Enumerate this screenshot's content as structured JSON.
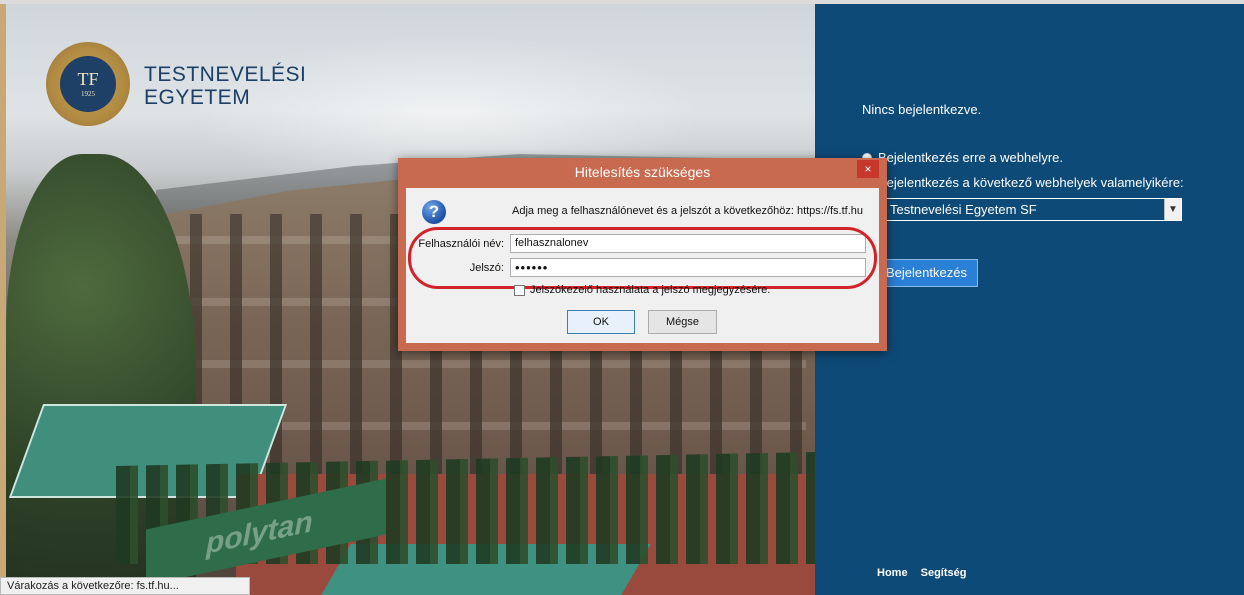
{
  "brand": {
    "line1": "TESTNEVELÉSI",
    "line2": "EGYETEM",
    "logo_letters": "TF",
    "logo_year": "1925"
  },
  "panel": {
    "not_logged_in": "Nincs bejelentkezve.",
    "option_this_site": "Bejelentkezés erre a webhelyre.",
    "option_other_sites": "Bejelentkezés a következő webhelyek valamelyikére:",
    "site_selected": "Testnevelési Egyetem SF",
    "login_button": "Bejelentkezés",
    "footer_home": "Home",
    "footer_help": "Segítség"
  },
  "dialog": {
    "title": "Hitelesítés szükséges",
    "close": "×",
    "prompt": "Adja meg a felhasználónevet és a jelszót a következőhöz: https://fs.tf.hu",
    "username_label": "Felhasználói név:",
    "username_value": "felhasznalonev",
    "password_label": "Jelszó:",
    "password_value": "••••••",
    "remember_label": "Jelszókezelő használata a jelszó megjegyzésére.",
    "ok_label": "OK",
    "cancel_label": "Mégse"
  },
  "photo": {
    "banner_text": "polytan"
  },
  "statusbar": {
    "text": "Várakozás a következőre: fs.tf.hu..."
  },
  "colors": {
    "panel_bg": "#0e4a78",
    "login_button": "#2a7fd6",
    "dialog_frame": "#c86a50",
    "highlight_oval": "#d2232a"
  }
}
